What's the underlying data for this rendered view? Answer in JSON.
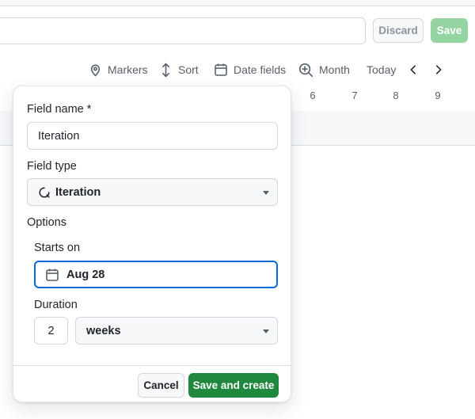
{
  "header": {
    "view_name_value": "",
    "discard_label": "Discard",
    "save_label": "Save"
  },
  "toolbar": {
    "markers_label": "Markers",
    "sort_label": "Sort",
    "date_fields_label": "Date fields",
    "zoom_label": "Month",
    "today_label": "Today",
    "icons": [
      "location-pin-icon",
      "sort-icon",
      "calendar-icon",
      "zoom-in-icon",
      "chevron-left-icon",
      "chevron-right-icon"
    ]
  },
  "calendar": {
    "visible_days": [
      "6",
      "7",
      "8",
      "9"
    ]
  },
  "new_field_dialog": {
    "field_name_label": "Field name *",
    "field_name_value": "Iteration",
    "field_type_label": "Field type",
    "field_type_value": "Iteration",
    "field_type_icon": "iteration-icon",
    "options_heading": "Options",
    "starts_on_label": "Starts on",
    "starts_on_value": "Aug 28",
    "duration_label": "Duration",
    "duration_number": "2",
    "duration_unit": "weeks",
    "cancel_label": "Cancel",
    "create_label": "Save and create"
  },
  "colors": {
    "primary_green": "#1f883d",
    "disabled_green": "#94d3a2",
    "focus_blue": "#0969da",
    "border": "#d0d7de"
  }
}
